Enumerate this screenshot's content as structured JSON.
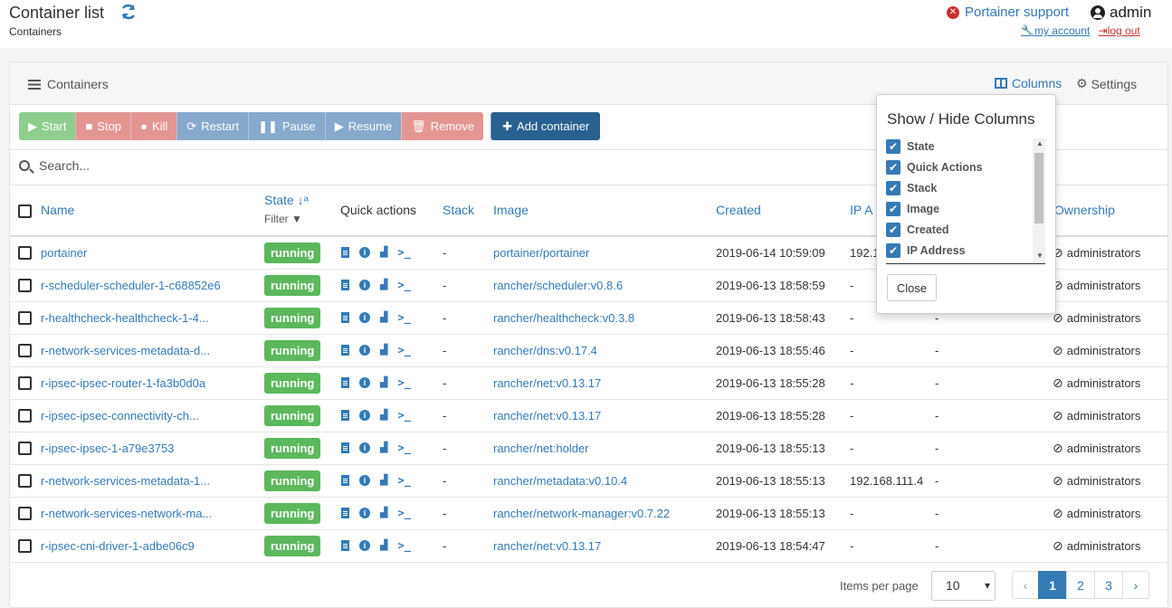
{
  "header": {
    "title": "Container list",
    "breadcrumb": "Containers",
    "support_label": "Portainer support",
    "username": "admin",
    "my_account_label": "my account",
    "logout_label": "log out"
  },
  "panel": {
    "title": "Containers",
    "columns_label": "Columns",
    "settings_label": "Settings"
  },
  "toolbar": {
    "start": "Start",
    "stop": "Stop",
    "kill": "Kill",
    "restart": "Restart",
    "pause": "Pause",
    "resume": "Resume",
    "remove": "Remove",
    "add": "Add container"
  },
  "search": {
    "placeholder": "Search..."
  },
  "table": {
    "headers": {
      "name": "Name",
      "state": "State",
      "state_filter": "Filter",
      "quick_actions": "Quick actions",
      "stack": "Stack",
      "image": "Image",
      "created": "Created",
      "ip": "IP A",
      "ownership": "Ownership"
    },
    "rows": [
      {
        "name": "portainer",
        "state": "running",
        "stack": "-",
        "image": "portainer/portainer",
        "created": "2019-06-14 10:59:09",
        "ip": "192.1",
        "ports": "",
        "ownership": "administrators"
      },
      {
        "name": "r-scheduler-scheduler-1-c68852e6",
        "state": "running",
        "stack": "-",
        "image": "rancher/scheduler:v0.8.6",
        "created": "2019-06-13 18:58:59",
        "ip": "-",
        "ports": "",
        "ownership": "administrators"
      },
      {
        "name": "r-healthcheck-healthcheck-1-4...",
        "state": "running",
        "stack": "-",
        "image": "rancher/healthcheck:v0.3.8",
        "created": "2019-06-13 18:58:43",
        "ip": "-",
        "ports": "-",
        "ownership": "administrators"
      },
      {
        "name": "r-network-services-metadata-d...",
        "state": "running",
        "stack": "-",
        "image": "rancher/dns:v0.17.4",
        "created": "2019-06-13 18:55:46",
        "ip": "-",
        "ports": "-",
        "ownership": "administrators"
      },
      {
        "name": "r-ipsec-ipsec-router-1-fa3b0d0a",
        "state": "running",
        "stack": "-",
        "image": "rancher/net:v0.13.17",
        "created": "2019-06-13 18:55:28",
        "ip": "-",
        "ports": "-",
        "ownership": "administrators"
      },
      {
        "name": "r-ipsec-ipsec-connectivity-ch...",
        "state": "running",
        "stack": "-",
        "image": "rancher/net:v0.13.17",
        "created": "2019-06-13 18:55:28",
        "ip": "-",
        "ports": "-",
        "ownership": "administrators"
      },
      {
        "name": "r-ipsec-ipsec-1-a79e3753",
        "state": "running",
        "stack": "-",
        "image": "rancher/net:holder",
        "created": "2019-06-13 18:55:13",
        "ip": "-",
        "ports": "-",
        "ownership": "administrators"
      },
      {
        "name": "r-network-services-metadata-1...",
        "state": "running",
        "stack": "-",
        "image": "rancher/metadata:v0.10.4",
        "created": "2019-06-13 18:55:13",
        "ip": "192.168.111.4",
        "ports": "-",
        "ownership": "administrators"
      },
      {
        "name": "r-network-services-network-ma...",
        "state": "running",
        "stack": "-",
        "image": "rancher/network-manager:v0.7.22",
        "created": "2019-06-13 18:55:13",
        "ip": "-",
        "ports": "-",
        "ownership": "administrators"
      },
      {
        "name": "r-ipsec-cni-driver-1-adbe06c9",
        "state": "running",
        "stack": "-",
        "image": "rancher/net:v0.13.17",
        "created": "2019-06-13 18:54:47",
        "ip": "-",
        "ports": "-",
        "ownership": "administrators"
      }
    ]
  },
  "pagination": {
    "items_per_page_label": "Items per page",
    "items_per_page": "10",
    "prev": "‹",
    "pages": [
      "1",
      "2",
      "3"
    ],
    "next": "›",
    "current_page": "1"
  },
  "columns_popover": {
    "title": "Show / Hide Columns",
    "items": [
      "State",
      "Quick Actions",
      "Stack",
      "Image",
      "Created",
      "IP Address"
    ],
    "close_label": "Close"
  },
  "icons": {
    "refresh": "refresh-icon",
    "support": "times-circle-icon",
    "user": "user-circle-icon",
    "columns": "columns-icon",
    "settings": "gear-icon",
    "ownership": "eye-slash-icon"
  },
  "colors": {
    "accent": "#337ab7",
    "running": "#5cb85c",
    "start": "#8fcd8f",
    "danger": "#e39592",
    "neutral": "#86a9cc",
    "add": "#286090"
  }
}
